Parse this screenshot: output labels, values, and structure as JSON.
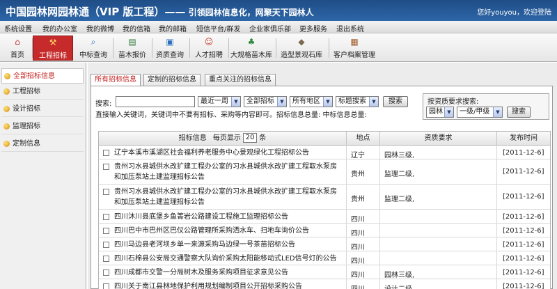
{
  "header": {
    "title": "中国园林网园林通（VIP 版工程）——",
    "slogan": " 引领园林信息化，网聚天下园林人",
    "welcome": "您好youyou，欢迎登陆"
  },
  "menu": [
    "系统设置",
    "我的办公室",
    "我的微博",
    "我的信箱",
    "我的邮箱",
    "短信平台/群发",
    "企业家俱乐部",
    "更多服务",
    "退出系统"
  ],
  "toolbar": [
    {
      "label": "首页",
      "icon": "home-icon"
    },
    {
      "label": "工程招标",
      "icon": "hammer-icon",
      "active": true
    },
    {
      "label": "中标查询",
      "icon": "query-icon"
    },
    {
      "label": "苗木报价",
      "icon": "price-icon"
    },
    {
      "label": "资质查询",
      "icon": "certificate-icon"
    },
    {
      "label": "人才招聘",
      "icon": "people-icon"
    },
    {
      "label": "大规格苗木库",
      "icon": "tree-icon"
    },
    {
      "label": "造型景观石库",
      "icon": "stone-icon"
    },
    {
      "label": "客户档案管理",
      "icon": "archive-icon"
    }
  ],
  "sidebar": [
    {
      "label": "全部招标信息",
      "active": true
    },
    {
      "label": "工程招标"
    },
    {
      "label": "设计招标"
    },
    {
      "label": "监理招标"
    },
    {
      "label": "定制信息"
    }
  ],
  "tabs": [
    "所有招标信息",
    "定制的招标信息",
    "重点关注的招标信息"
  ],
  "search": {
    "label": "搜索:",
    "input_value": "",
    "period": "最近一周",
    "category": "全部招标",
    "region": "所有地区",
    "mode": "标题搜索",
    "button": "搜索",
    "hint": "直接输入关键词，关键词中不要有招标、采购等内容即可。招标信息总量:  中标信息总量:"
  },
  "qualification": {
    "label": "按资质要求搜索:",
    "type": "园林",
    "level": "一级/甲级",
    "button": "搜索"
  },
  "table": {
    "col_title": "招标信息",
    "per_page_label": "每页显示",
    "per_page_value": "20",
    "per_page_unit": "条",
    "col_location": "地点",
    "col_requirement": "资质要求",
    "col_time": "发布时间",
    "rows": [
      {
        "title": "辽宁本溪市溪湖区社会福利养老服务中心景观绿化工程招标公告",
        "location": "辽宁",
        "requirement": "园林三级,",
        "time": "[2011-12-6]"
      },
      {
        "title": "贵州习水县城供水改扩建工程办公室的习水县城供水改扩建工程取水泵房和加压泵站土建监理招标公告",
        "location": "贵州",
        "requirement": "监理二级,",
        "time": "[2011-12-6]"
      },
      {
        "title": "贵州习水县城供水改扩建工程办公室的习水县城供水改扩建工程取水泵房和加压泵站土建监理招标公告",
        "location": "贵州",
        "requirement": "监理二级,",
        "time": "[2011-12-6]"
      },
      {
        "title": "四川沐川县底堡乡鱼箐岩公路建设工程施工监理招标公告",
        "location": "四川",
        "requirement": "",
        "time": "[2011-12-6]"
      },
      {
        "title": "四川巴中市巴州区巴仪公路管理所采购洒水车、扫地车询价公告",
        "location": "四川",
        "requirement": "",
        "time": "[2011-12-6]"
      },
      {
        "title": "四川马边县老河坝乡单一来源采购马边绿一号茶苗招标公告",
        "location": "四川",
        "requirement": "",
        "time": "[2011-12-6]"
      },
      {
        "title": "四川石棉县公安局交通警察大队询价采购太阳能移动式LED信号灯的公告",
        "location": "四川",
        "requirement": "",
        "time": "[2011-12-6]"
      },
      {
        "title": "四川成都市交警一分局树木及服务采购项目征求意见公告",
        "location": "四川",
        "requirement": "园林三级,",
        "time": "[2011-12-6]"
      },
      {
        "title": "四川关于南江县林地保护利用规划编制项目公开招标采购公告",
        "location": "四川",
        "requirement": "设计二级,",
        "time": "[2011-12-6]"
      }
    ]
  },
  "colors": {
    "header_bg": "#2d66a8",
    "active_red": "#c62a2a",
    "active_text": "#c62020"
  }
}
